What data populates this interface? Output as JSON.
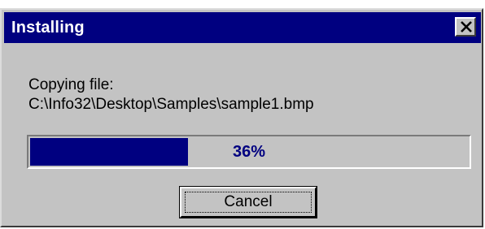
{
  "window": {
    "title": "Installing",
    "close_icon": "close-icon"
  },
  "status": {
    "line1": "Copying file:",
    "line2": "C:\\Info32\\Desktop\\Samples\\sample1.bmp"
  },
  "progress": {
    "fraction": 0.36,
    "label": "36%"
  },
  "buttons": {
    "cancel_label": "Cancel"
  },
  "colors": {
    "title_bar": "#000080",
    "face": "#c3c3c3",
    "progress_fill": "#000080",
    "progress_text": "#000080"
  }
}
